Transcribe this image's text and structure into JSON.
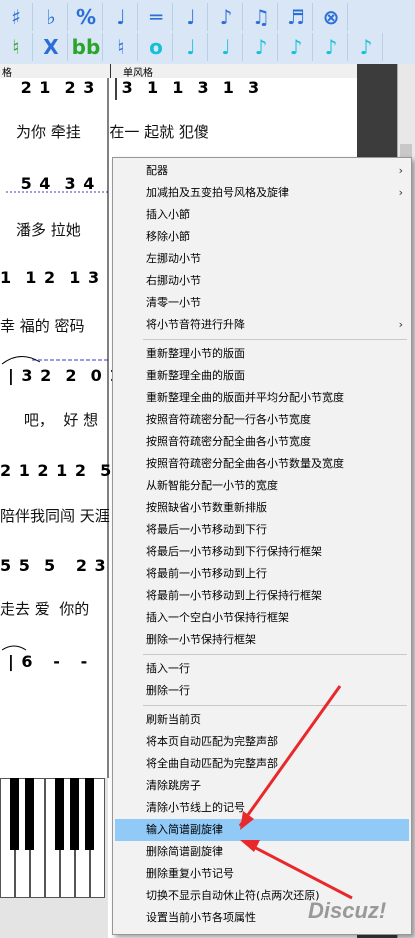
{
  "toolbar": {
    "row1": [
      {
        "glyph": "♯",
        "name": "sharp-icon",
        "color": "#2b6fd6"
      },
      {
        "glyph": "♭",
        "name": "flat-icon",
        "color": "#2b6fd6"
      },
      {
        "glyph": "%",
        "name": "percent-icon",
        "color": "#2b6fd6"
      },
      {
        "glyph": "♩",
        "name": "quarter-note-icon",
        "color": "#2b6fd6"
      },
      {
        "glyph": "═",
        "name": "double-bar-icon",
        "color": "#2b6fd6"
      },
      {
        "glyph": "♩",
        "name": "note-icon",
        "color": "#2b6fd6"
      },
      {
        "glyph": "♪",
        "name": "eighth-note-icon",
        "color": "#2b6fd6"
      },
      {
        "glyph": "♫",
        "name": "beamed-notes-icon",
        "color": "#2b6fd6"
      },
      {
        "glyph": "♬",
        "name": "sixteenth-notes-icon",
        "color": "#2b6fd6"
      },
      {
        "glyph": "⊗",
        "name": "cancel-note-icon",
        "color": "#2b6fd6"
      }
    ],
    "row2": [
      {
        "glyph": "♮",
        "name": "natural-green-icon",
        "color": "#2aa52a"
      },
      {
        "glyph": "X",
        "name": "double-sharp-icon",
        "color": "#2b6fd6"
      },
      {
        "glyph": "bb",
        "name": "double-flat-icon",
        "color": "#2aa52a"
      },
      {
        "glyph": "♮",
        "name": "natural-icon",
        "color": "#2b6fd6"
      },
      {
        "glyph": "o",
        "name": "whole-note-icon",
        "color": "#14c0d8"
      },
      {
        "glyph": "♩",
        "name": "half-note-icon",
        "color": "#14c0d8"
      },
      {
        "glyph": "♩",
        "name": "quarter-cyan-icon",
        "color": "#14c0d8"
      },
      {
        "glyph": "♪",
        "name": "eighth-cyan-icon",
        "color": "#14c0d8"
      },
      {
        "glyph": "♪",
        "name": "sixteenth-cyan-icon",
        "color": "#14c0d8"
      },
      {
        "glyph": "♪",
        "name": "thirtysecond-cyan-icon",
        "color": "#14c0d8"
      },
      {
        "glyph": "♪",
        "name": "sixtyfourth-cyan-icon",
        "color": "#14c0d8"
      }
    ]
  },
  "ruler": {
    "left_label": "格",
    "right_label": "单风格"
  },
  "score": {
    "lines": [
      {
        "notes": " 2 1  2 3    3  1  1  3  1  3",
        "lyrics": "为你 牵挂      在一 起就 犯傻"
      },
      {
        "notes": " 5 4  3 4",
        "lyrics": "潘多 拉她"
      },
      {
        "notes": "1  1 2  1 3",
        "lyrics": "幸 福的 密码"
      },
      {
        "notes": "| 3 2  2  0 1  2",
        "lyrics": "     吧，  好 想"
      },
      {
        "notes": "2 1 2 1 2  5",
        "lyrics": "陪伴我同闯 天涯"
      },
      {
        "notes": "5 5  5   2 3",
        "lyrics": "走去 爱  你的"
      },
      {
        "notes": "| 6   -   -",
        "lyrics": ""
      }
    ]
  },
  "menu": {
    "items": [
      {
        "label": "配器",
        "submenu": true
      },
      {
        "label": "加减拍及五变拍号风格及旋律",
        "submenu": true
      },
      {
        "label": "插入小節"
      },
      {
        "label": "移除小節"
      },
      {
        "label": "左挪动小节"
      },
      {
        "label": "右挪动小节"
      },
      {
        "label": "清零一小节"
      },
      {
        "label": "将小节音符进行升降",
        "submenu": true
      },
      {
        "label": "重新整理小节的版面"
      },
      {
        "label": "重新整理全曲的版面"
      },
      {
        "label": "重新整理全曲的版面并平均分配小节宽度"
      },
      {
        "label": "按照音符疏密分配一行各小节宽度"
      },
      {
        "label": "按照音符疏密分配全曲各小节宽度"
      },
      {
        "label": "按照音符疏密分配全曲各小节数量及宽度"
      },
      {
        "label": "从新智能分配一小节的宽度"
      },
      {
        "label": "按照缺省小节数重新排版"
      },
      {
        "label": "将最后一小节移动到下行"
      },
      {
        "label": "将最后一小节移动到下行保持行框架"
      },
      {
        "label": "将最前一小节移动到上行"
      },
      {
        "label": "将最前一小节移动到上行保持行框架"
      },
      {
        "label": "插入一个空白小节保持行框架"
      },
      {
        "label": "删除一小节保持行框架"
      },
      {
        "label": "插入一行"
      },
      {
        "label": "删除一行"
      },
      {
        "label": "刷新当前页"
      },
      {
        "label": "将本页自动匹配为完整声部"
      },
      {
        "label": "将全曲自动匹配为完整声部"
      },
      {
        "label": "清除跳房子"
      },
      {
        "label": "清除小节线上的记号"
      },
      {
        "label": "输入简谱副旋律",
        "highlighted": true
      },
      {
        "label": "删除简谱副旋律"
      },
      {
        "label": "删除重复小节记号"
      },
      {
        "label": "切换不显示自动休止符(点两次还原)"
      },
      {
        "label": "设置当前小节各项属性"
      }
    ],
    "highlight_color": "#91c9f7"
  },
  "annotation": {
    "arrow_color": "#e8282a"
  },
  "watermark": "Discuz!"
}
